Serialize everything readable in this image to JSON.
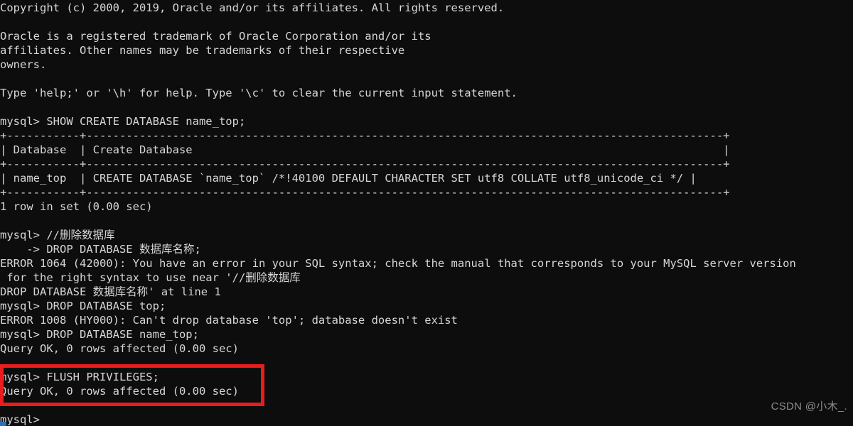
{
  "terminal": {
    "prompt": "mysql>",
    "continuation_prompt": "->",
    "background_color": "#0d0d0d",
    "text_color": "#d6d6d6",
    "lines": [
      "Copyright (c) 2000, 2019, Oracle and/or its affiliates. All rights reserved.",
      "",
      "Oracle is a registered trademark of Oracle Corporation and/or its",
      "affiliates. Other names may be trademarks of their respective",
      "owners.",
      "",
      "Type 'help;' or '\\h' for help. Type '\\c' to clear the current input statement.",
      "",
      "mysql> SHOW CREATE DATABASE name_top;",
      "+-----------+------------------------------------------------------------------------------------------------+",
      "| Database  | Create Database                                                                                |",
      "+-----------+------------------------------------------------------------------------------------------------+",
      "| name_top  | CREATE DATABASE `name_top` /*!40100 DEFAULT CHARACTER SET utf8 COLLATE utf8_unicode_ci */ |",
      "+-----------+------------------------------------------------------------------------------------------------+",
      "1 row in set (0.00 sec)",
      "",
      "mysql> //删除数据库",
      "    -> DROP DATABASE 数据库名称;",
      "ERROR 1064 (42000): You have an error in your SQL syntax; check the manual that corresponds to your MySQL server version",
      " for the right syntax to use near '//删除数据库",
      "DROP DATABASE 数据库名称' at line 1",
      "mysql> DROP DATABASE top;",
      "ERROR 1008 (HY000): Can't drop database 'top'; database doesn't exist",
      "mysql> DROP DATABASE name_top;",
      "Query OK, 0 rows affected (0.00 sec)",
      "",
      "mysql> FLUSH PRIVILEGES;",
      "Query OK, 0 rows affected (0.00 sec)",
      "",
      "mysql>"
    ]
  },
  "annotation": {
    "highlight_color": "#ea1c1c",
    "highlighted_text": "mysql> FLUSH PRIVILEGES;\nQuery OK, 0 rows affected (0.00 sec)"
  },
  "watermark": {
    "text": "CSDN @小木_."
  },
  "cursor": {
    "color": "#2f6fb5"
  }
}
